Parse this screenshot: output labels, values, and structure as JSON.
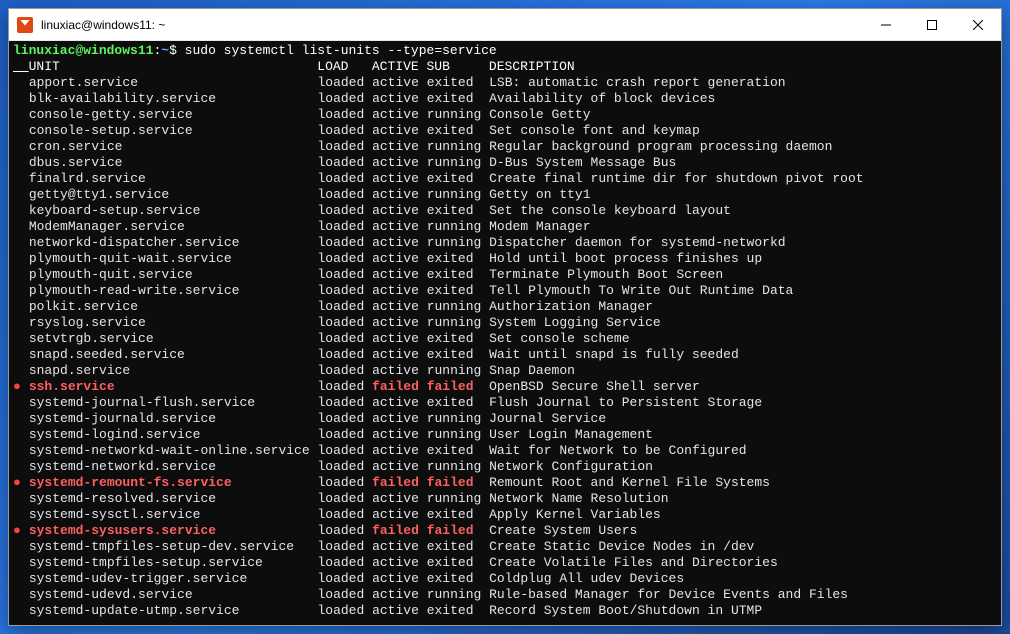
{
  "window": {
    "title": "linuxiac@windows11: ~"
  },
  "prompt": {
    "user_host": "linuxiac@windows11",
    "sep": ":",
    "path": "~",
    "dollar": "$",
    "command": "sudo systemctl list-units --type=service"
  },
  "headers": {
    "unit": "UNIT",
    "load": "LOAD",
    "active": "ACTIVE",
    "sub": "SUB",
    "description": "DESCRIPTION"
  },
  "rows": [
    {
      "marker": "",
      "unit": "apport.service",
      "load": "loaded",
      "active": "active",
      "sub": "exited",
      "desc": "LSB: automatic crash report generation",
      "failed": false
    },
    {
      "marker": "",
      "unit": "blk-availability.service",
      "load": "loaded",
      "active": "active",
      "sub": "exited",
      "desc": "Availability of block devices",
      "failed": false
    },
    {
      "marker": "",
      "unit": "console-getty.service",
      "load": "loaded",
      "active": "active",
      "sub": "running",
      "desc": "Console Getty",
      "failed": false
    },
    {
      "marker": "",
      "unit": "console-setup.service",
      "load": "loaded",
      "active": "active",
      "sub": "exited",
      "desc": "Set console font and keymap",
      "failed": false
    },
    {
      "marker": "",
      "unit": "cron.service",
      "load": "loaded",
      "active": "active",
      "sub": "running",
      "desc": "Regular background program processing daemon",
      "failed": false
    },
    {
      "marker": "",
      "unit": "dbus.service",
      "load": "loaded",
      "active": "active",
      "sub": "running",
      "desc": "D-Bus System Message Bus",
      "failed": false
    },
    {
      "marker": "",
      "unit": "finalrd.service",
      "load": "loaded",
      "active": "active",
      "sub": "exited",
      "desc": "Create final runtime dir for shutdown pivot root",
      "failed": false
    },
    {
      "marker": "",
      "unit": "getty@tty1.service",
      "load": "loaded",
      "active": "active",
      "sub": "running",
      "desc": "Getty on tty1",
      "failed": false
    },
    {
      "marker": "",
      "unit": "keyboard-setup.service",
      "load": "loaded",
      "active": "active",
      "sub": "exited",
      "desc": "Set the console keyboard layout",
      "failed": false
    },
    {
      "marker": "",
      "unit": "ModemManager.service",
      "load": "loaded",
      "active": "active",
      "sub": "running",
      "desc": "Modem Manager",
      "failed": false
    },
    {
      "marker": "",
      "unit": "networkd-dispatcher.service",
      "load": "loaded",
      "active": "active",
      "sub": "running",
      "desc": "Dispatcher daemon for systemd-networkd",
      "failed": false
    },
    {
      "marker": "",
      "unit": "plymouth-quit-wait.service",
      "load": "loaded",
      "active": "active",
      "sub": "exited",
      "desc": "Hold until boot process finishes up",
      "failed": false
    },
    {
      "marker": "",
      "unit": "plymouth-quit.service",
      "load": "loaded",
      "active": "active",
      "sub": "exited",
      "desc": "Terminate Plymouth Boot Screen",
      "failed": false
    },
    {
      "marker": "",
      "unit": "plymouth-read-write.service",
      "load": "loaded",
      "active": "active",
      "sub": "exited",
      "desc": "Tell Plymouth To Write Out Runtime Data",
      "failed": false
    },
    {
      "marker": "",
      "unit": "polkit.service",
      "load": "loaded",
      "active": "active",
      "sub": "running",
      "desc": "Authorization Manager",
      "failed": false
    },
    {
      "marker": "",
      "unit": "rsyslog.service",
      "load": "loaded",
      "active": "active",
      "sub": "running",
      "desc": "System Logging Service",
      "failed": false
    },
    {
      "marker": "",
      "unit": "setvtrgb.service",
      "load": "loaded",
      "active": "active",
      "sub": "exited",
      "desc": "Set console scheme",
      "failed": false
    },
    {
      "marker": "",
      "unit": "snapd.seeded.service",
      "load": "loaded",
      "active": "active",
      "sub": "exited",
      "desc": "Wait until snapd is fully seeded",
      "failed": false
    },
    {
      "marker": "",
      "unit": "snapd.service",
      "load": "loaded",
      "active": "active",
      "sub": "running",
      "desc": "Snap Daemon",
      "failed": false
    },
    {
      "marker": "●",
      "unit": "ssh.service",
      "load": "loaded",
      "active": "failed",
      "sub": "failed",
      "desc": "OpenBSD Secure Shell server",
      "failed": true
    },
    {
      "marker": "",
      "unit": "systemd-journal-flush.service",
      "load": "loaded",
      "active": "active",
      "sub": "exited",
      "desc": "Flush Journal to Persistent Storage",
      "failed": false
    },
    {
      "marker": "",
      "unit": "systemd-journald.service",
      "load": "loaded",
      "active": "active",
      "sub": "running",
      "desc": "Journal Service",
      "failed": false
    },
    {
      "marker": "",
      "unit": "systemd-logind.service",
      "load": "loaded",
      "active": "active",
      "sub": "running",
      "desc": "User Login Management",
      "failed": false
    },
    {
      "marker": "",
      "unit": "systemd-networkd-wait-online.service",
      "load": "loaded",
      "active": "active",
      "sub": "exited",
      "desc": "Wait for Network to be Configured",
      "failed": false
    },
    {
      "marker": "",
      "unit": "systemd-networkd.service",
      "load": "loaded",
      "active": "active",
      "sub": "running",
      "desc": "Network Configuration",
      "failed": false
    },
    {
      "marker": "●",
      "unit": "systemd-remount-fs.service",
      "load": "loaded",
      "active": "failed",
      "sub": "failed",
      "desc": "Remount Root and Kernel File Systems",
      "failed": true
    },
    {
      "marker": "",
      "unit": "systemd-resolved.service",
      "load": "loaded",
      "active": "active",
      "sub": "running",
      "desc": "Network Name Resolution",
      "failed": false
    },
    {
      "marker": "",
      "unit": "systemd-sysctl.service",
      "load": "loaded",
      "active": "active",
      "sub": "exited",
      "desc": "Apply Kernel Variables",
      "failed": false
    },
    {
      "marker": "●",
      "unit": "systemd-sysusers.service",
      "load": "loaded",
      "active": "failed",
      "sub": "failed",
      "desc": "Create System Users",
      "failed": true
    },
    {
      "marker": "",
      "unit": "systemd-tmpfiles-setup-dev.service",
      "load": "loaded",
      "active": "active",
      "sub": "exited",
      "desc": "Create Static Device Nodes in /dev",
      "failed": false
    },
    {
      "marker": "",
      "unit": "systemd-tmpfiles-setup.service",
      "load": "loaded",
      "active": "active",
      "sub": "exited",
      "desc": "Create Volatile Files and Directories",
      "failed": false
    },
    {
      "marker": "",
      "unit": "systemd-udev-trigger.service",
      "load": "loaded",
      "active": "active",
      "sub": "exited",
      "desc": "Coldplug All udev Devices",
      "failed": false
    },
    {
      "marker": "",
      "unit": "systemd-udevd.service",
      "load": "loaded",
      "active": "active",
      "sub": "running",
      "desc": "Rule-based Manager for Device Events and Files",
      "failed": false
    },
    {
      "marker": "",
      "unit": "systemd-update-utmp.service",
      "load": "loaded",
      "active": "active",
      "sub": "exited",
      "desc": "Record System Boot/Shutdown in UTMP",
      "failed": false
    }
  ],
  "cols": {
    "unit_w": 37,
    "load_w": 7,
    "active_w": 7,
    "sub_w": 8
  }
}
